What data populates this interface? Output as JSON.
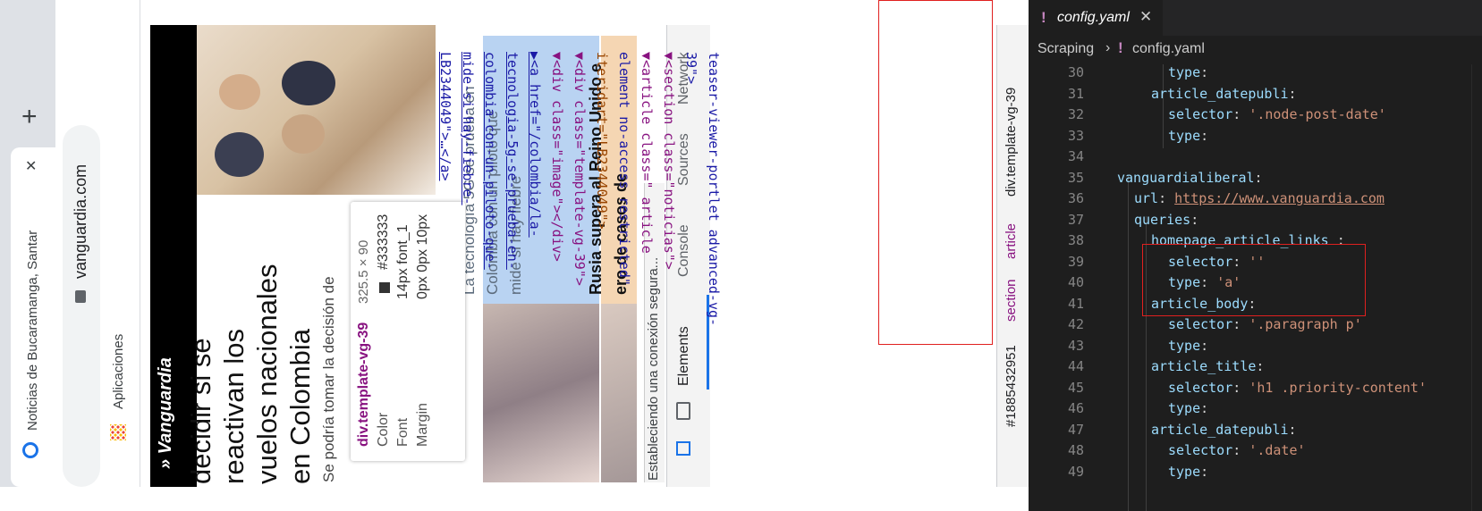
{
  "browser": {
    "tab_title": "Noticias de Bucaramanga, Santar",
    "new_tab": "+",
    "close_tab": "✕",
    "url": "vanguardia.com",
    "bookmarks_label": "Aplicaciones",
    "status_text": "Estableciendo una conexión segura..."
  },
  "page": {
    "logo": "» Vanguardia",
    "headline_lines": [
      "decidir si se",
      "reactivan los",
      "vuelos nacionales",
      "en Colombia"
    ],
    "sub": "Se podría tomar la decisión de",
    "card1_lines": [
      "La tecnología 5G se prueba en",
      "Colombia con un piloto que",
      "mide si hay fiebre"
    ],
    "card2_lines": [
      "Rusia supera al Reino Unido e",
      "ero de casos de"
    ]
  },
  "tooltip": {
    "name": "div.template-vg-39",
    "size": "325.5 × 90",
    "rows": [
      {
        "label": "Color",
        "value": "#333333"
      },
      {
        "label": "Font",
        "value": "14px font_1"
      },
      {
        "label": "Margin",
        "value": "0px 0px 10px"
      }
    ]
  },
  "devtools": {
    "tabs": [
      "Elements",
      "Console",
      "Sources",
      "Network"
    ],
    "code_lines": [
      "teaser-viewer-portlet advanced-vg-",
      "39\">",
      "▼<section class=\"noticias\">",
      "  ▼<article class=\" article",
      "   element  no-access restricted\"",
      "   iteridart=\"LB2344049\">",
      "▼<div class=\"template-vg-39\">",
      "  ▼<div class=\"image\"></div>",
      "  ▶<a href=\"/colombia/la-",
      "   tecnologia-5g-se-prueba-en-",
      "   colombia-con-un-piloto-que-",
      "   mide-si-hay-fiebre-",
      "   LB2344049\">…</a>"
    ],
    "breadcrumbs": [
      "#1885432951",
      "section",
      "article",
      "div.template-vg-39"
    ]
  },
  "editor": {
    "tab_label": "config.yaml",
    "breadcrumb_folder": "Scraping",
    "breadcrumb_file": "config.yaml",
    "lines": [
      {
        "n": "30",
        "indent": 4,
        "key": "type",
        "sep": ":",
        "val": ""
      },
      {
        "n": "31",
        "indent": 3,
        "key": "article_datepubli",
        "sep": ":",
        "val": ""
      },
      {
        "n": "32",
        "indent": 4,
        "key": "selector",
        "sep": ": ",
        "val": "'.node-post-date'"
      },
      {
        "n": "33",
        "indent": 4,
        "key": "type",
        "sep": ":",
        "val": ""
      },
      {
        "n": "34",
        "indent": 0,
        "key": "",
        "sep": "",
        "val": ""
      },
      {
        "n": "35",
        "indent": 1,
        "key": "vanguardialiberal",
        "sep": ":",
        "val": ""
      },
      {
        "n": "36",
        "indent": 2,
        "key": "url",
        "sep": ": ",
        "val": "https://www.vanguardia.com"
      },
      {
        "n": "37",
        "indent": 2,
        "key": "queries",
        "sep": ":",
        "val": ""
      },
      {
        "n": "38",
        "indent": 3,
        "key": "homepage_article_links",
        "sep": " :",
        "val": ""
      },
      {
        "n": "39",
        "indent": 4,
        "key": "selector",
        "sep": ": ",
        "val": "''"
      },
      {
        "n": "40",
        "indent": 4,
        "key": "type",
        "sep": ": ",
        "val": "'a'"
      },
      {
        "n": "41",
        "indent": 3,
        "key": "article_body",
        "sep": ":",
        "val": ""
      },
      {
        "n": "42",
        "indent": 4,
        "key": "selector",
        "sep": ": ",
        "val": "'.paragraph p'"
      },
      {
        "n": "43",
        "indent": 4,
        "key": "type",
        "sep": ":",
        "val": ""
      },
      {
        "n": "44",
        "indent": 3,
        "key": "article_title",
        "sep": ":",
        "val": ""
      },
      {
        "n": "45",
        "indent": 4,
        "key": "selector",
        "sep": ": ",
        "val": "'h1 .priority-content'"
      },
      {
        "n": "46",
        "indent": 4,
        "key": "type",
        "sep": ":",
        "val": ""
      },
      {
        "n": "47",
        "indent": 3,
        "key": "article_datepubli",
        "sep": ":",
        "val": ""
      },
      {
        "n": "48",
        "indent": 4,
        "key": "selector",
        "sep": ": ",
        "val": "'.date'"
      },
      {
        "n": "49",
        "indent": 4,
        "key": "type",
        "sep": ":",
        "val": ""
      }
    ]
  },
  "colors": {
    "highlight_red": "#e0201f",
    "yaml_key": "#9cdcfe",
    "yaml_string": "#ce9178",
    "devtools_tag": "#881280",
    "devtools_attr": "#994500",
    "devtools_value": "#1a1aa6"
  }
}
